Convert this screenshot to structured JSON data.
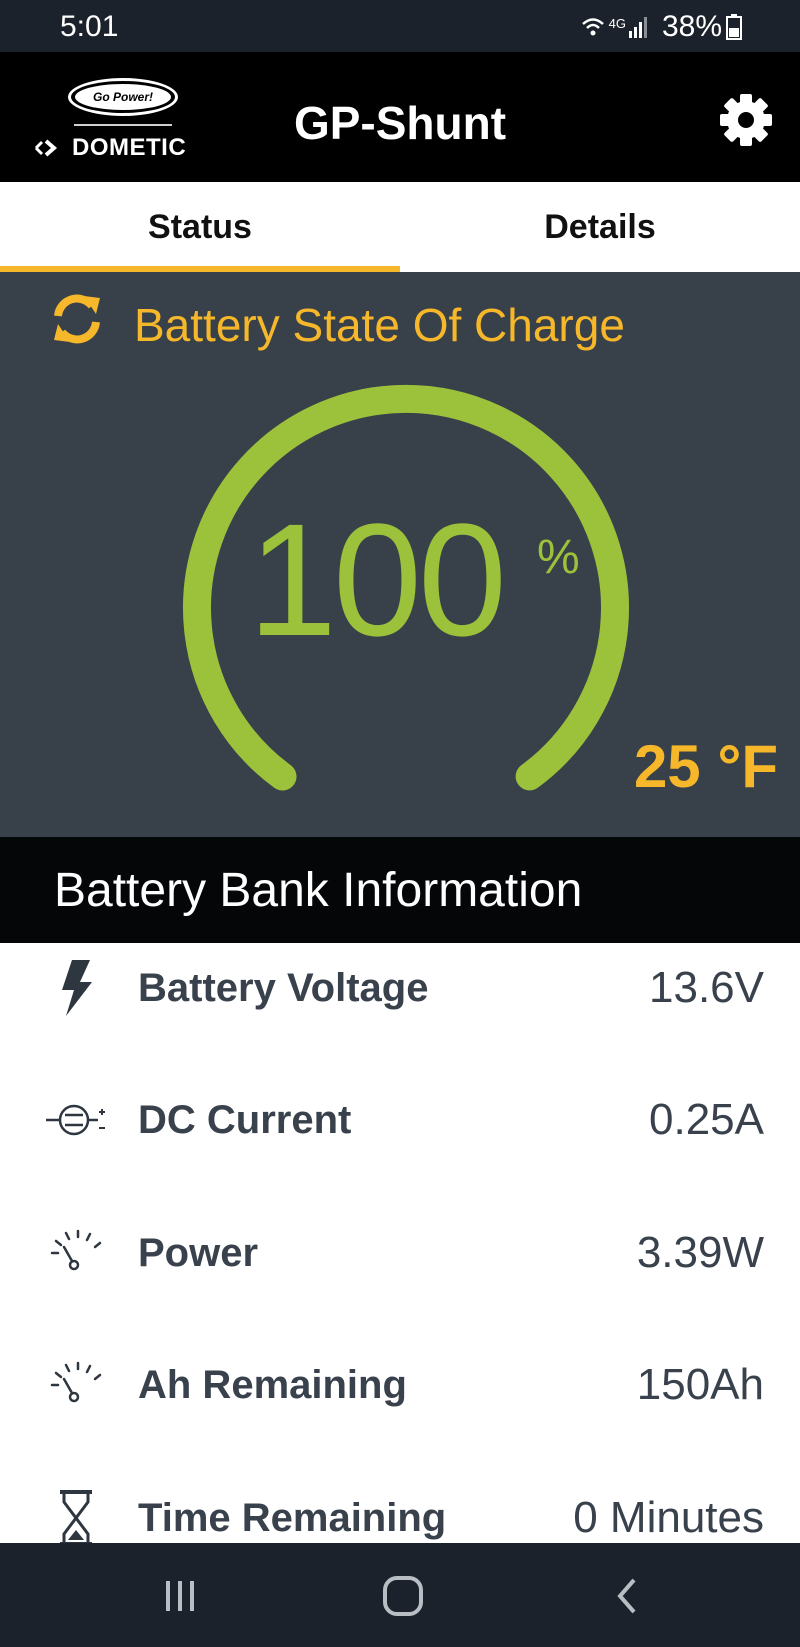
{
  "status_bar": {
    "time": "5:01",
    "network": "4G",
    "battery_percent": "38%",
    "icons": [
      "wifi-icon",
      "signal-icon",
      "battery-icon"
    ]
  },
  "header": {
    "logo": {
      "badge_text": "Go Power!",
      "brand": "DOMETIC"
    },
    "title": "GP-Shunt",
    "settings_icon": "gear-icon"
  },
  "tabs": [
    {
      "label": "Status",
      "active": true
    },
    {
      "label": "Details",
      "active": false
    }
  ],
  "soc": {
    "title": "Battery State Of Charge",
    "value": "100",
    "unit": "%",
    "level_fraction": 1.0,
    "temperature": "25 °F",
    "refresh_icon": "refresh-icon"
  },
  "battery_bank": {
    "title": "Battery Bank Information",
    "rows": [
      {
        "icon": "lightning-icon",
        "label": "Battery Voltage",
        "value": "13.6V"
      },
      {
        "icon": "current-icon",
        "label": "DC Current",
        "value": "0.25A"
      },
      {
        "icon": "gauge-icon",
        "label": "Power",
        "value": "3.39W"
      },
      {
        "icon": "gauge-icon",
        "label": "Ah Remaining",
        "value": "150Ah"
      },
      {
        "icon": "hourglass-icon",
        "label": "Time Remaining",
        "value": "0 Minutes"
      }
    ]
  },
  "nav_bar": {
    "buttons": [
      "recent-apps-icon",
      "home-icon",
      "back-icon"
    ]
  },
  "colors": {
    "accent": "#f6b82a",
    "gauge_green": "#9cc13b",
    "panel_bg": "#384049",
    "header_bg": "#000000",
    "text_dark": "#39424c"
  }
}
